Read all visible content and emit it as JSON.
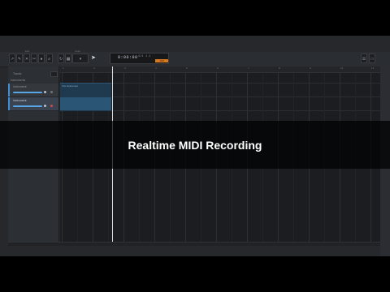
{
  "toolbar": {
    "tool_caption": "Edit",
    "snap_caption": "Snap",
    "transport_time": "0:00:00",
    "transport_meta_1": "4/4",
    "transport_meta_2": "1.1",
    "tempo_value": "120"
  },
  "left_panel": {
    "header_label": "Tracks",
    "section_label": "Instruments",
    "tracks": [
      {
        "name": "Instrument"
      },
      {
        "name": "Instrument"
      }
    ]
  },
  "arrange": {
    "bar_numbers": [
      "1",
      "2",
      "3",
      "4",
      "5",
      "6",
      "7",
      "8",
      "9",
      "10",
      "11"
    ],
    "clip_name": "Vox Instrument"
  },
  "overlay": {
    "title": "Realtime MIDI Recording"
  },
  "colors": {
    "accent_blue": "#3f8fd4",
    "tempo_orange": "#d9791e",
    "clip_selected": "#2b5574"
  }
}
